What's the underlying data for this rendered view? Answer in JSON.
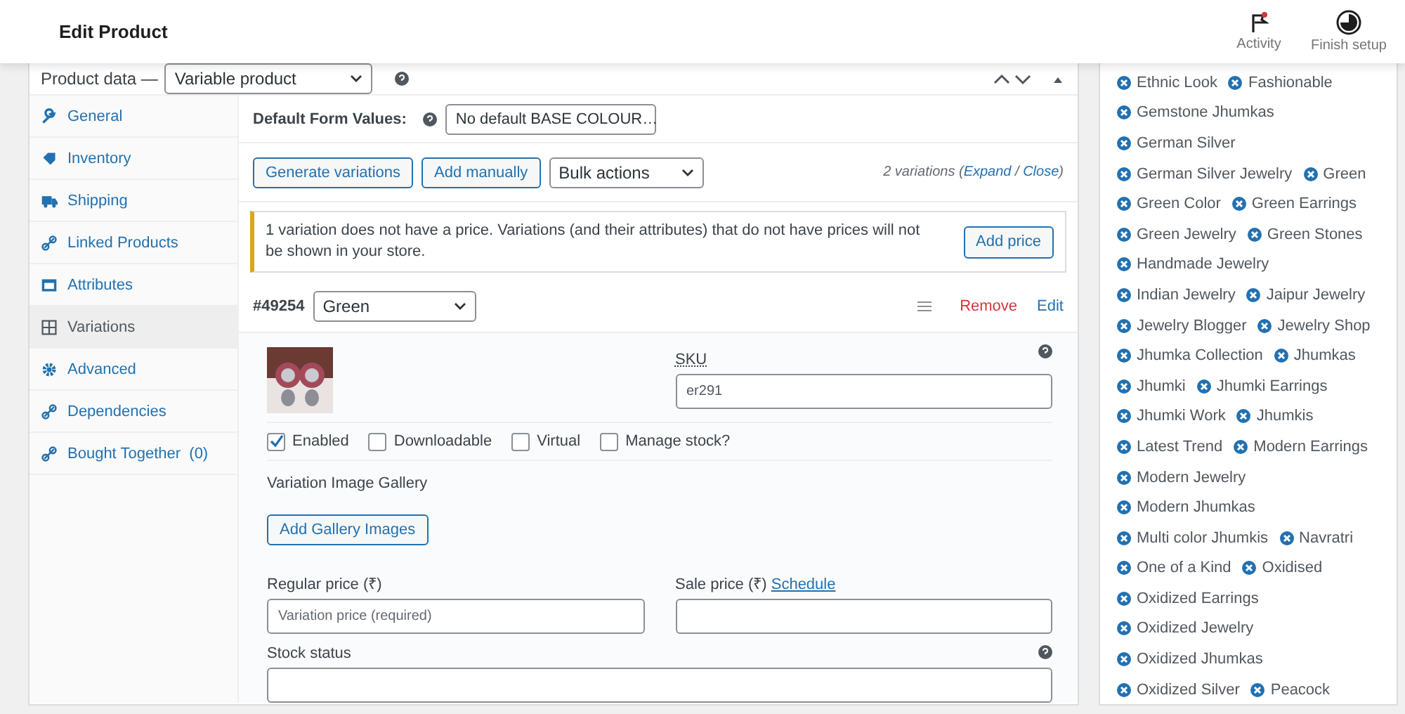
{
  "header": {
    "title": "Edit Product",
    "actions": [
      {
        "label": "Activity",
        "kind": "flag"
      },
      {
        "label": "Finish setup",
        "kind": "progress"
      }
    ]
  },
  "product_data": {
    "label": "Product data —",
    "type_select": "Variable product"
  },
  "tabs": [
    {
      "label": "General",
      "selected": false
    },
    {
      "label": "Inventory",
      "selected": false
    },
    {
      "label": "Shipping",
      "selected": false
    },
    {
      "label": "Linked Products",
      "selected": false
    },
    {
      "label": "Attributes",
      "selected": false
    },
    {
      "label": "Variations",
      "selected": true
    },
    {
      "label": "Advanced",
      "selected": false
    },
    {
      "label": "Dependencies",
      "selected": false
    },
    {
      "label": "Bought Together",
      "count": "(0)",
      "selected": false
    }
  ],
  "default_form": {
    "label": "Default Form Values:",
    "select": "No default BASE COLOUR…"
  },
  "toolbar": {
    "buttons": [
      "Generate variations",
      "Add manually"
    ],
    "bulk": "Bulk actions",
    "count": "2 variations (",
    "expand": "Expand",
    "sep": " / ",
    "close": "Close",
    "end": ")"
  },
  "notice": {
    "text": "1 variation does not have a price. Variations (and their attributes) that do not have prices will not be shown in your store.",
    "button": "Add price"
  },
  "variation": {
    "id": "#49254",
    "attribute": "Green",
    "remove": "Remove",
    "edit": "Edit",
    "sku_label": "SKU",
    "sku": "er291",
    "options": [
      {
        "label": "Enabled",
        "checked": true
      },
      {
        "label": "Downloadable",
        "checked": false
      },
      {
        "label": "Virtual",
        "checked": false
      },
      {
        "label": "Manage stock?",
        "checked": false
      }
    ],
    "gallery_label": "Variation Image Gallery",
    "gallery_button": "Add Gallery Images",
    "regular_label": "Regular price (₹)",
    "regular_placeholder": "Variation price (required)",
    "sale_label": "Sale price (₹)",
    "schedule": "Schedule",
    "stock_label": "Stock status"
  },
  "tag_rows": [
    [
      "Ethnic Look",
      "Fashionable"
    ],
    [
      "Gemstone Jhumkas"
    ],
    [
      "German Silver"
    ],
    [
      "German Silver Jewelry",
      "Green"
    ],
    [
      "Green Color",
      "Green Earrings"
    ],
    [
      "Green Jewelry",
      "Green Stones"
    ],
    [
      "Handmade Jewelry"
    ],
    [
      "Indian Jewelry",
      "Jaipur Jewelry"
    ],
    [
      "Jewelry Blogger",
      "Jewelry Shop"
    ],
    [
      "Jhumka Collection",
      "Jhumkas"
    ],
    [
      "Jhumki",
      "Jhumki Earrings"
    ],
    [
      "Jhumki Work",
      "Jhumkis"
    ],
    [
      "Latest Trend",
      "Modern Earrings"
    ],
    [
      "Modern Jewelry"
    ],
    [
      "Modern Jhumkas"
    ],
    [
      "Multi color Jhumkis",
      "Navratri"
    ],
    [
      "One of a Kind",
      "Oxidised"
    ],
    [
      "Oxidized Earrings"
    ],
    [
      "Oxidized Jewelry"
    ],
    [
      "Oxidized Jhumkas"
    ],
    [
      "Oxidized Silver",
      "Peacock"
    ]
  ]
}
